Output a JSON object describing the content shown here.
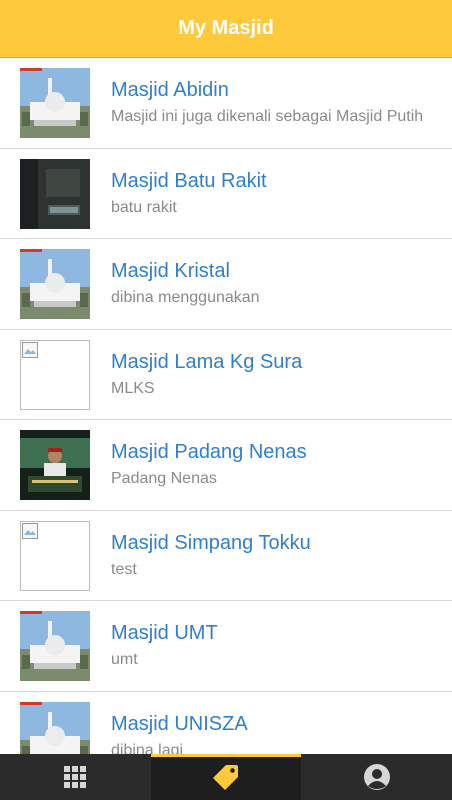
{
  "header": {
    "title": "My Masjid",
    "color": "#ffc93c"
  },
  "masjids": [
    {
      "name": "Masjid Abidin",
      "description": "Masjid ini juga dikenali sebagai Masjid Putih",
      "image": "mosque-photo"
    },
    {
      "name": "Masjid Batu Rakit",
      "description": "batu rakit",
      "image": "dark-photo"
    },
    {
      "name": "Masjid Kristal",
      "description": "dibina menggunakan",
      "image": "mosque-photo"
    },
    {
      "name": "Masjid Lama Kg Sura",
      "description": "MLKS",
      "image": "broken-image"
    },
    {
      "name": "Masjid Padang Nenas",
      "description": "Padang Nenas",
      "image": "speaker-photo"
    },
    {
      "name": "Masjid Simpang Tokku",
      "description": "test",
      "image": "broken-image"
    },
    {
      "name": "Masjid UMT",
      "description": "umt",
      "image": "mosque-photo"
    },
    {
      "name": "Masjid UNISZA",
      "description": "dibina lagi",
      "image": "mosque-photo"
    }
  ],
  "tabbar": {
    "tabs": [
      {
        "icon": "grid-icon",
        "active": false
      },
      {
        "icon": "tag-icon",
        "active": true
      },
      {
        "icon": "profile-icon",
        "active": false
      }
    ],
    "active_color": "#ffc93c"
  }
}
